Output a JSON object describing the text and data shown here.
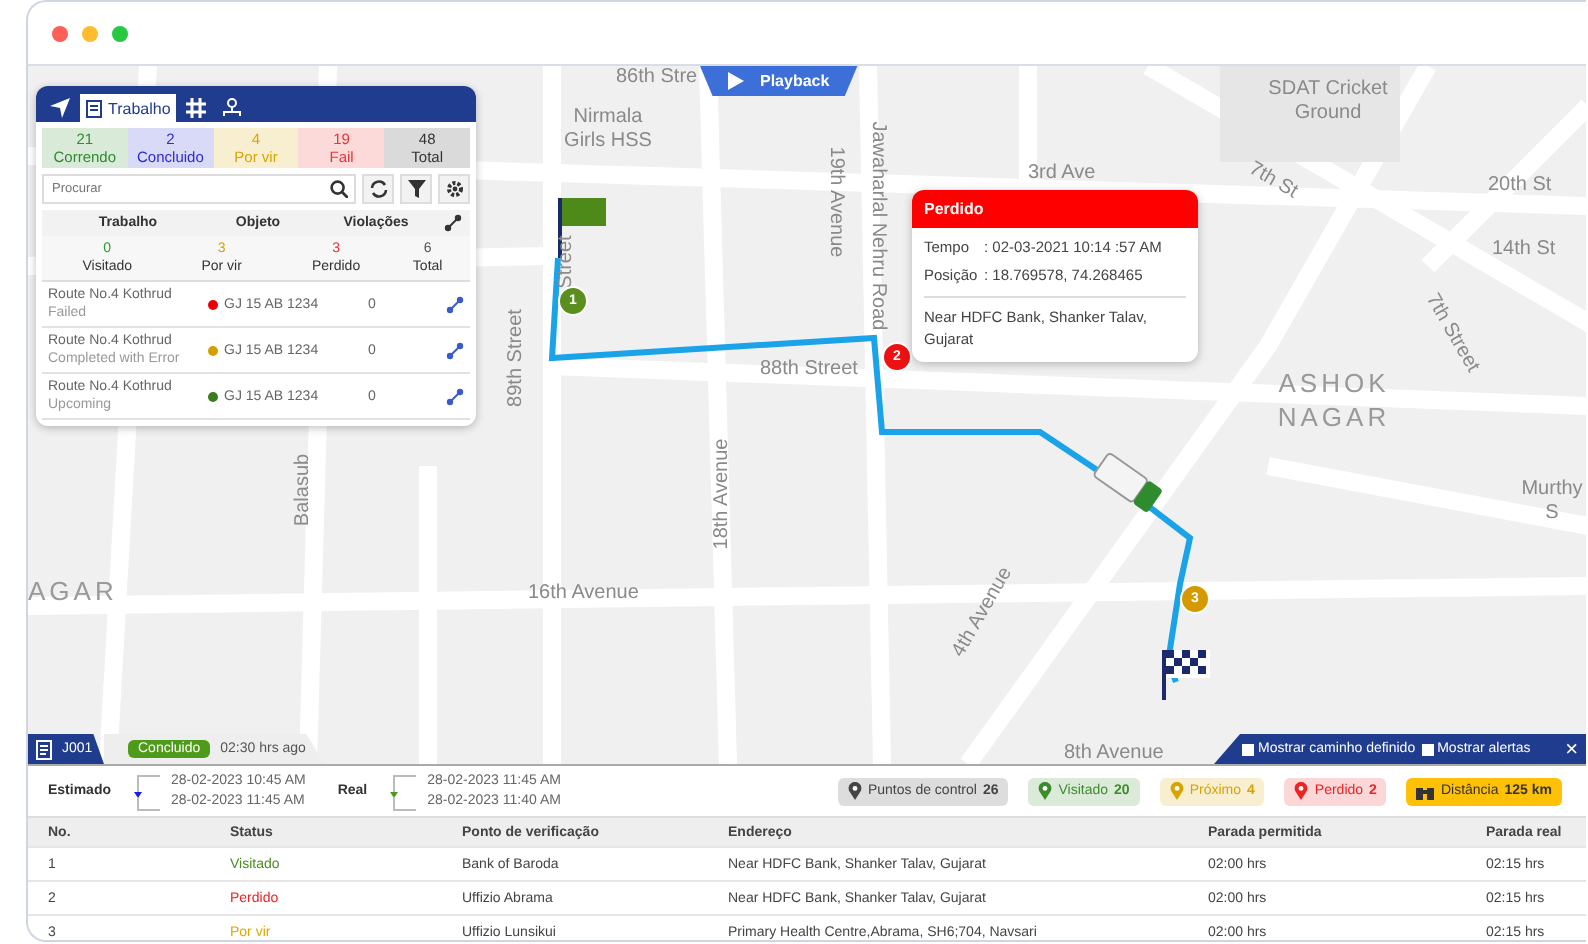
{
  "playback": {
    "label": "Playback"
  },
  "map": {
    "labels": [
      {
        "text": "86th Stre"
      },
      {
        "text": "Nirmala Girls HSS"
      },
      {
        "text": "Street"
      },
      {
        "text": "89th Street"
      },
      {
        "text": "88th Street"
      },
      {
        "text": "19th Avenue"
      },
      {
        "text": "Jawaharlal Nehru Road"
      },
      {
        "text": "3rd Ave"
      },
      {
        "text": "SDAT Cricket Ground"
      },
      {
        "text": "7th St"
      },
      {
        "text": "20th St"
      },
      {
        "text": "14th St"
      },
      {
        "text": "7th Street"
      },
      {
        "text": "ASHOK NAGAR"
      },
      {
        "text": "Murthy S"
      },
      {
        "text": "18th Avenue"
      },
      {
        "text": "Balasub"
      },
      {
        "text": "AGAR"
      },
      {
        "text": "16th Avenue"
      },
      {
        "text": "4th Avenue"
      },
      {
        "text": "8th Avenue"
      }
    ],
    "markers": [
      {
        "number": "1",
        "color": "#5a8f1e"
      },
      {
        "number": "2",
        "color": "#ee1111"
      },
      {
        "number": "3",
        "color": "#d49a00"
      }
    ]
  },
  "panel": {
    "tabs": [
      {
        "kind": "navigate",
        "selected": false
      },
      {
        "kind": "jobs",
        "label": "Trabalho",
        "selected": true
      },
      {
        "kind": "grid",
        "selected": false
      },
      {
        "kind": "hierarchy",
        "selected": false
      }
    ],
    "summary": [
      {
        "count": "21",
        "label": "Correndo",
        "color": "#2e8b2e"
      },
      {
        "count": "2",
        "label": "Concluido",
        "color": "#2b2bd6"
      },
      {
        "count": "4",
        "label": "Por vir",
        "color": "#d9a400"
      },
      {
        "count": "19",
        "label": "Fail",
        "color": "#ee3333"
      },
      {
        "count": "48",
        "label": "Total",
        "color": "#333333"
      }
    ],
    "search": {
      "placeholder": "Procurar"
    },
    "columns": [
      "Trabalho",
      "Objeto",
      "Violações"
    ],
    "stats": [
      {
        "count": "0",
        "label": "Visitado",
        "color": "#2e9b2e"
      },
      {
        "count": "3",
        "label": "Por vir",
        "color": "#d9a400"
      },
      {
        "count": "3",
        "label": "Perdido",
        "color": "#ee3333"
      },
      {
        "count": "6",
        "label": "Total",
        "color": "#555555"
      }
    ],
    "rows": [
      {
        "route": "Route No.4 Kothrud",
        "status": "Failed",
        "color": "#ee0000",
        "object": "GJ 15 AB 1234",
        "violations": "0"
      },
      {
        "route": "Route No.4 Kothrud",
        "status": "Completed with Error",
        "color": "#d4a000",
        "object": "GJ 15 AB 1234",
        "violations": "0"
      },
      {
        "route": "Route No.4 Kothrud",
        "status": "Upcoming",
        "color": "#3a7d1e",
        "object": "GJ 15 AB 1234",
        "violations": "0"
      }
    ]
  },
  "popup": {
    "title": "Perdido",
    "fields": [
      {
        "label": "Tempo",
        "value": ": 02-03-2021 10:14 :57 AM"
      },
      {
        "label": "Posição",
        "value": ": 18.769578, 74.268465"
      }
    ],
    "address": "Near HDFC Bank, Shanker Talav, Gujarat"
  },
  "footer": {
    "job": "J001",
    "status": "Concluido",
    "ago": "02:30 hrs ago",
    "options": [
      {
        "label": "Mostrar caminho definido",
        "checked": false
      },
      {
        "label": "Mostrar alertas",
        "checked": false
      }
    ],
    "close": "×"
  },
  "schedule": [
    {
      "label": "Estimado",
      "color": "#1a1aee",
      "start": "28-02-2023 10:45 AM",
      "end": "28-02-2023 11:45 AM"
    },
    {
      "label": "Real",
      "color": "#4a9a1e",
      "start": "28-02-2023 11:45 AM",
      "end": "28-02-2023 11:40 AM"
    }
  ],
  "chips": [
    {
      "kind": "pin",
      "label": "Puntos de control",
      "count": "26",
      "color": "#444444"
    },
    {
      "kind": "pin",
      "label": "Visitado",
      "count": "20",
      "color": "#3c8c2c"
    },
    {
      "kind": "pin",
      "label": "Próximo",
      "count": "4",
      "color": "#d9a400"
    },
    {
      "kind": "pin",
      "label": "Perdido",
      "count": "2",
      "color": "#ee2222"
    },
    {
      "kind": "distance",
      "label": "Distância",
      "count": "125 km",
      "color": "#ffc107"
    }
  ],
  "table": {
    "columns": [
      "No.",
      "Status",
      "Ponto de verificação",
      "Endereço",
      "Parada permitida",
      "Parada real"
    ],
    "rows": [
      {
        "no": "1",
        "status": "Visitado",
        "color": "#4a8c1e",
        "point": "Bank of Baroda",
        "address": "Near HDFC Bank, Shanker Talav, Gujarat",
        "allowed": "02:00 hrs",
        "actual": "02:15 hrs"
      },
      {
        "no": "2",
        "status": "Perdido",
        "color": "#ee2222",
        "point": "Uffizio Abrama",
        "address": "Near HDFC Bank, Shanker Talav, Gujarat",
        "allowed": "02:00 hrs",
        "actual": "02:15 hrs"
      },
      {
        "no": "3",
        "status": "Por vir",
        "color": "#e0a800",
        "point": "Uffizio Lunsikui",
        "address": "Primary Health Centre,Abrama, SH6;704, Navsari",
        "allowed": "02:00 hrs",
        "actual": "02:15 hrs"
      }
    ]
  }
}
